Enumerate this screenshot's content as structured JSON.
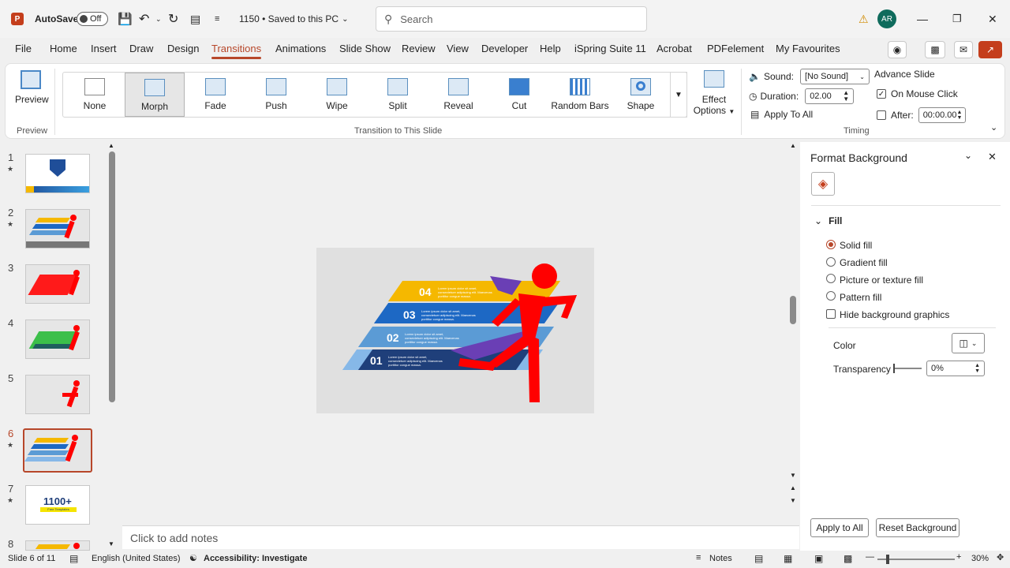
{
  "titlebar": {
    "app_logo": "P",
    "autosave_label": "AutoSave",
    "autosave_state": "Off",
    "file_status": "1150 • Saved to this PC",
    "search_placeholder": "Search",
    "user_initials": "AR"
  },
  "tabs": [
    "File",
    "Home",
    "Insert",
    "Draw",
    "Design",
    "Transitions",
    "Animations",
    "Slide Show",
    "Review",
    "View",
    "Developer",
    "Help",
    "iSpring Suite 11",
    "Acrobat",
    "PDFelement",
    "My Favourites"
  ],
  "active_tab": "Transitions",
  "ribbon": {
    "preview_label": "Preview",
    "preview_group": "Preview",
    "transitions": [
      "None",
      "Morph",
      "Fade",
      "Push",
      "Wipe",
      "Split",
      "Reveal",
      "Cut",
      "Random Bars",
      "Shape"
    ],
    "selected_transition": "Morph",
    "effect_options_line1": "Effect",
    "effect_options_line2": "Options",
    "transition_group": "Transition to This Slide",
    "sound_label": "Sound:",
    "sound_value": "[No Sound]",
    "duration_label": "Duration:",
    "duration_value": "02.00",
    "apply_all": "Apply To All",
    "advance_slide": "Advance Slide",
    "on_mouse_click": "On Mouse Click",
    "after_label": "After:",
    "after_value": "00:00.00",
    "timing_group": "Timing"
  },
  "thumbnails": [
    {
      "num": "1",
      "star": true
    },
    {
      "num": "2",
      "star": true
    },
    {
      "num": "3",
      "star": false
    },
    {
      "num": "4",
      "star": false
    },
    {
      "num": "5",
      "star": false
    },
    {
      "num": "6",
      "star": true
    },
    {
      "num": "7",
      "star": true
    },
    {
      "num": "8",
      "star": true
    }
  ],
  "thumb7_text": "1100+",
  "thumb7_sub": "Free Templates",
  "slide": {
    "items": [
      {
        "num": "04",
        "text": "Lorem ipsum dolor sit amet, consectetuer adipiscing elit. Maecenas porttitor congue massa."
      },
      {
        "num": "03",
        "text": "Lorem ipsum dolor sit amet, consectetuer adipiscing elit. Maecenas porttitor congue massa."
      },
      {
        "num": "02",
        "text": "Lorem ipsum dolor sit amet, consectetuer adipiscing elit. Maecenas porttitor congue massa."
      },
      {
        "num": "01",
        "text": "Lorem ipsum dolor sit amet, consectetuer adipiscing elit. Maecenas porttitor congue massa."
      }
    ]
  },
  "notes_placeholder": "Click to add notes",
  "pane": {
    "title": "Format Background",
    "section": "Fill",
    "options": [
      "Solid fill",
      "Gradient fill",
      "Picture or texture fill",
      "Pattern fill"
    ],
    "selected_option": "Solid fill",
    "hide_graphics": "Hide background graphics",
    "color_label": "Color",
    "transparency_label": "Transparency",
    "transparency_value": "0%",
    "apply_all": "Apply to All",
    "reset": "Reset Background"
  },
  "status": {
    "slide_info": "Slide 6 of 11",
    "language": "English (United States)",
    "accessibility": "Accessibility: Investigate",
    "notes": "Notes",
    "zoom": "30%"
  },
  "colors": {
    "accent": "#b7472a",
    "runner_red": "#ff0000",
    "purple": "#6a3fb5",
    "bar4": "#f5b800",
    "bar3": "#1d68c4",
    "bar2": "#5b9bd5",
    "bar1": "#86b8e8"
  }
}
